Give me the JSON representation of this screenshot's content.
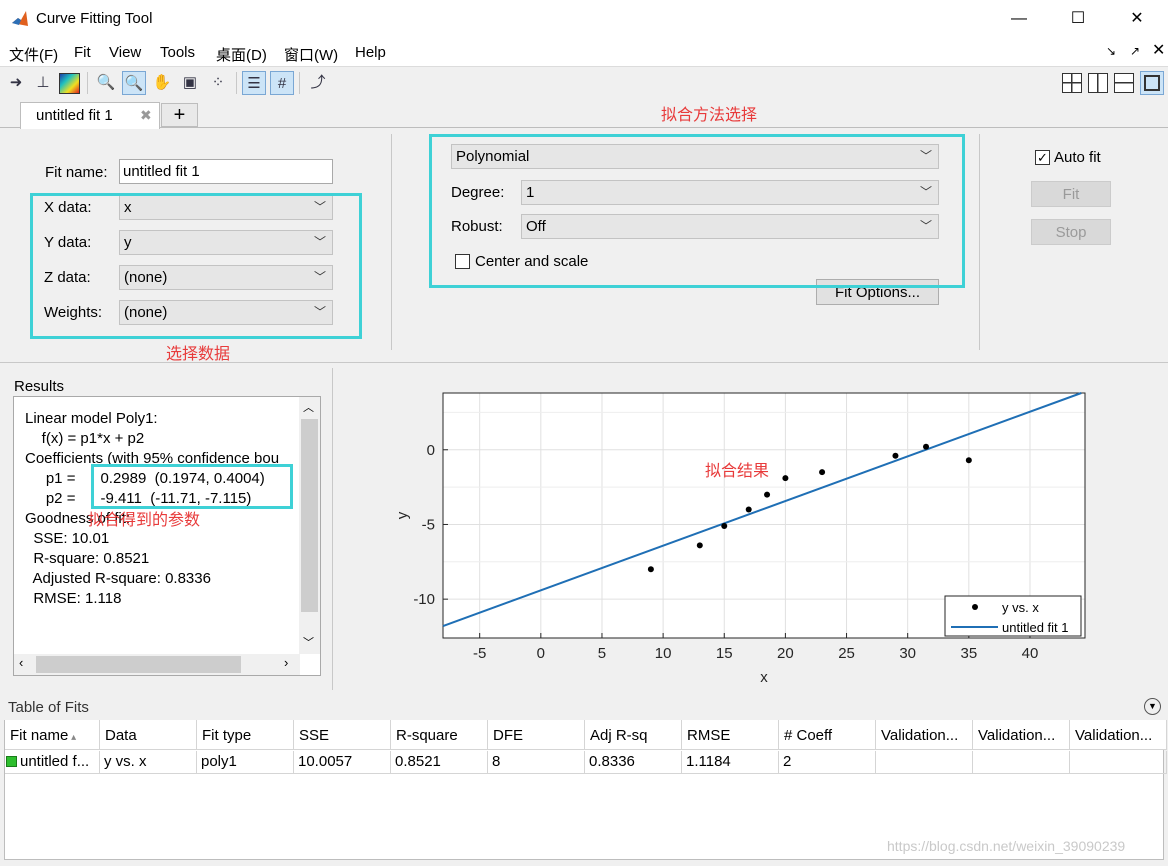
{
  "window": {
    "title": "Curve Fitting Tool",
    "minimize": "—",
    "maximize": "☐",
    "close": "✕"
  },
  "menu": [
    "文件(F)",
    "Fit",
    "View",
    "Tools",
    "桌面(D)",
    "窗口(W)",
    "Help"
  ],
  "tabs": {
    "active": "untitled fit 1",
    "close": "✖",
    "add": "+"
  },
  "data_section": {
    "fit_name_label": "Fit name:",
    "fit_name_value": "untitled fit 1",
    "x_label": "X data:",
    "x_value": "x",
    "y_label": "Y data:",
    "y_value": "y",
    "z_label": "Z data:",
    "z_value": "(none)",
    "w_label": "Weights:",
    "w_value": "(none)",
    "annotation": "选择数据"
  },
  "method_section": {
    "type_value": "Polynomial",
    "degree_label": "Degree:",
    "degree_value": "1",
    "robust_label": "Robust:",
    "robust_value": "Off",
    "center_label": "Center and scale",
    "fit_options": "Fit Options...",
    "annotation": "拟合方法选择"
  },
  "controls": {
    "auto_fit": "Auto fit",
    "fit": "Fit",
    "stop": "Stop",
    "auto_fit_checked": true
  },
  "results": {
    "title": "Results",
    "lines": [
      "Linear model Poly1:",
      "    f(x) = p1*x + p2",
      "Coefficients (with 95% confidence bou",
      "     p1 =      0.2989  (0.1974, 0.4004)",
      "     p2 =      -9.411  (-11.71, -7.115)",
      "",
      "Goodness of fit:",
      "  SSE: 10.01",
      "  R-square: 0.8521",
      "  Adjusted R-square: 0.8336",
      "  RMSE: 1.118"
    ],
    "annotation": "拟合得到的参数"
  },
  "chart_data": {
    "type": "scatter",
    "xlabel": "x",
    "ylabel": "y",
    "xlim": [
      -8,
      44.5
    ],
    "ylim": [
      -12.6,
      3.8
    ],
    "xticks": [
      -5,
      0,
      5,
      10,
      15,
      20,
      25,
      30,
      35,
      40
    ],
    "yticks": [
      0,
      -5,
      -10
    ],
    "grid": true,
    "legend_position": "bottom-right",
    "series": [
      {
        "name": "y vs. x",
        "kind": "points",
        "x": [
          9,
          13,
          15,
          17,
          18.5,
          20,
          23,
          29,
          31.5,
          35
        ],
        "y": [
          -8,
          -6.4,
          -5.1,
          -4,
          -3,
          -1.9,
          -1.5,
          -0.4,
          0.2,
          -0.7
        ]
      },
      {
        "name": "untitled fit 1",
        "kind": "line",
        "p1": 0.2989,
        "p2": -9.411
      }
    ],
    "annotation": "拟合结果",
    "colors": {
      "points": "#000000",
      "line": "#1f6fb5"
    }
  },
  "table": {
    "title": "Table of Fits",
    "columns": [
      "Fit name",
      "Data",
      "Fit type",
      "SSE",
      "R-square",
      "DFE",
      "Adj R-sq",
      "RMSE",
      "# Coeff",
      "Validation...",
      "Validation...",
      "Validation..."
    ],
    "rows": [
      [
        "untitled f...",
        "y vs. x",
        "poly1",
        "10.0057",
        "0.8521",
        "8",
        "0.8336",
        "1.1184",
        "2",
        "",
        "",
        ""
      ]
    ]
  },
  "watermark": "https://blog.csdn.net/weixin_39090239"
}
